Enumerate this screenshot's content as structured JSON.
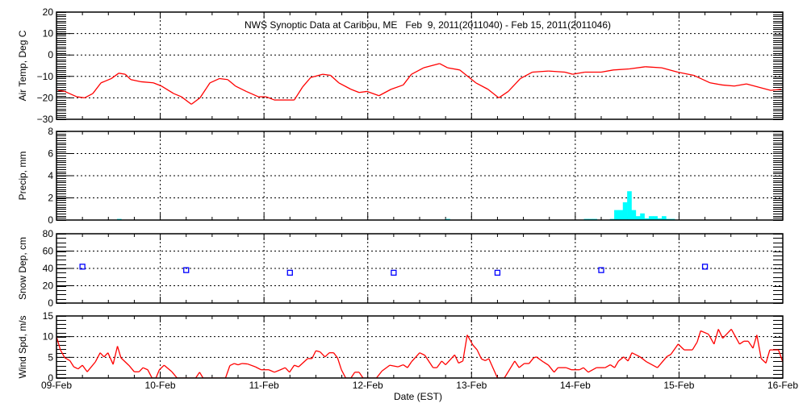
{
  "chart_data": [
    {
      "type": "line",
      "title": "NWS Synoptic Data at Caribou, ME   Feb  9, 2011(2011040) - Feb 15, 2011(2011046)",
      "ylabel": "Air Temp, Deg C",
      "ylim": [
        -30,
        20
      ],
      "yticks": [
        "20",
        "10",
        "0",
        "−10",
        "−20",
        "−30"
      ],
      "ytick_values": [
        20,
        10,
        0,
        -10,
        -20,
        -30
      ],
      "color": "#ff0000",
      "x_hours": [
        0.4,
        1.9,
        4.7,
        6.5,
        8.4,
        10.3,
        12.7,
        14.4,
        15.9,
        17.2,
        19.6,
        22.4,
        24.3,
        27.1,
        28.9,
        31.2,
        33.2,
        35.5,
        37.7,
        39.6,
        41.4,
        43.9,
        46.7,
        48.5,
        50.4,
        53.2,
        55.0,
        56.9,
        58.8,
        61.6,
        63.4,
        65.3,
        68.1,
        70.0,
        71.8,
        74.6,
        77.4,
        80.2,
        82.1,
        84.9,
        88.6,
        90.5,
        93.3,
        97.0,
        99.8,
        102.3,
        104.5,
        107.3,
        110.1,
        113.8,
        117.6,
        119.4,
        122.2,
        126.0,
        128.8,
        132.5,
        136.2,
        140.0,
        143.7,
        147.4,
        151.2,
        154.0,
        156.8,
        159.6,
        162.4,
        165.2,
        167.6
      ],
      "values": [
        -16.5,
        -17,
        -19.5,
        -20,
        -18,
        -13,
        -11,
        -8.5,
        -9,
        -11.5,
        -12.5,
        -13,
        -14.5,
        -18,
        -19.5,
        -23,
        -20,
        -13,
        -11,
        -11.5,
        -14.5,
        -17,
        -19.5,
        -19.5,
        -21,
        -21,
        -21,
        -15,
        -10.5,
        -9,
        -9.5,
        -13,
        -16,
        -17.5,
        -17,
        -19,
        -16,
        -14,
        -9,
        -6,
        -4,
        -6,
        -7,
        -13,
        -16,
        -20,
        -17,
        -11,
        -8,
        -7.5,
        -8,
        -9,
        -8,
        -8,
        -7,
        -6.5,
        -5.5,
        -6,
        -8,
        -9.5,
        -13,
        -14,
        -14.5,
        -13.5,
        -15,
        -16.5,
        -16
      ]
    },
    {
      "type": "bar",
      "ylabel": "Precip, mm",
      "ylim": [
        0,
        8
      ],
      "yticks": [
        "8",
        "6",
        "4",
        "2",
        "0"
      ],
      "ytick_values": [
        8,
        6,
        4,
        2,
        0
      ],
      "color": "#00ffff",
      "x_hours": [
        14,
        90,
        122,
        123,
        124,
        128,
        129,
        130,
        131,
        132,
        133,
        134,
        135,
        136,
        137,
        138,
        139,
        140,
        141,
        142
      ],
      "values": [
        0.1,
        0.1,
        0.1,
        0.1,
        0.1,
        0.1,
        0.9,
        0.9,
        1.6,
        2.6,
        0.9,
        0.35,
        0.6,
        0.15,
        0.35,
        0.35,
        0.15,
        0.35,
        0.1,
        0.1
      ]
    },
    {
      "type": "scatter",
      "ylabel": "Snow Dep, cm",
      "ylim": [
        0,
        80
      ],
      "yticks": [
        "80",
        "60",
        "40",
        "20",
        "0"
      ],
      "ytick_values": [
        80,
        60,
        40,
        20,
        0
      ],
      "color": "#0000ff",
      "x_hours": [
        6,
        30,
        54,
        78,
        102,
        126,
        150
      ],
      "values": [
        42,
        38,
        35,
        35,
        35,
        38,
        42
      ]
    },
    {
      "type": "line",
      "ylabel": "Wind Spd, m/s",
      "xlabel": "Date (EST)",
      "ylim": [
        0,
        15
      ],
      "yticks": [
        "15",
        "10",
        "5",
        "0"
      ],
      "ytick_values": [
        15,
        10,
        5,
        0
      ],
      "color": "#ff0000",
      "xticks": [
        "09-Feb",
        "10-Feb",
        "11-Feb",
        "12-Feb",
        "13-Feb",
        "14-Feb",
        "15-Feb",
        "16-Feb"
      ],
      "xlim_hours": [
        0,
        168
      ],
      "x_hours": [
        0,
        0.9,
        1.9,
        3.1,
        4.0,
        5.0,
        6.0,
        7.1,
        9.0,
        10.1,
        11.0,
        11.9,
        13.1,
        14.1,
        14.9,
        16.8,
        18.0,
        19.1,
        20.0,
        21.1,
        22.1,
        23.0,
        23.8,
        24.9,
        26.7,
        27.9,
        32.2,
        33.1,
        33.9,
        39.1,
        40.1,
        41.1,
        42.0,
        42.9,
        44.2,
        46.0,
        47.3,
        49.1,
        50.4,
        51.6,
        52.9,
        53.9,
        55.0,
        56.0,
        58.1,
        59.1,
        60.0,
        61.0,
        62.1,
        63.1,
        64.1,
        65.0,
        65.9,
        66.9,
        68.1,
        69.0,
        70.0,
        70.9,
        74.0,
        75.3,
        77.1,
        79.0,
        80.2,
        81.2,
        82.1,
        84.0,
        85.2,
        87.1,
        88.0,
        89.1,
        90.0,
        92.1,
        93.0,
        94.0,
        95.0,
        96.3,
        97.3,
        98.3,
        99.2,
        100.0,
        102.0,
        103.6,
        106.0,
        107.0,
        108.2,
        109.3,
        110.4,
        111.0,
        112.6,
        113.8,
        115.1,
        116.0,
        117.9,
        119.1,
        121.0,
        121.9,
        123.0,
        124.9,
        126.9,
        128.1,
        129.1,
        130.0,
        131.2,
        132.2,
        133.1,
        135.0,
        136.5,
        139.0,
        141.2,
        142.1,
        143.8,
        145.2,
        147.1,
        148.2,
        149.0,
        150.8,
        152.1,
        153.1,
        154.1,
        156.1,
        158.0,
        159.0,
        160.0,
        161.1,
        162.0,
        163.0,
        164.1,
        165.0,
        167.0,
        168.0
      ],
      "values": [
        10,
        6.8,
        4.9,
        4.2,
        2.7,
        2.2,
        3.1,
        1.5,
        3.9,
        6.1,
        5.1,
        6.1,
        3.3,
        7.7,
        4.9,
        3,
        1.5,
        1.5,
        2.5,
        2,
        0,
        0,
        2,
        3.1,
        1.5,
        0,
        0,
        1.4,
        0,
        0,
        3,
        3.5,
        3.2,
        3.5,
        3.4,
        2.7,
        2,
        2,
        1.4,
        1.9,
        2.5,
        1.4,
        3.1,
        2.7,
        4.7,
        4.7,
        6.6,
        6.3,
        5.1,
        6.1,
        6.1,
        4.9,
        2,
        0,
        0,
        1.4,
        1.4,
        0,
        0,
        1.7,
        3.1,
        2.7,
        3.2,
        2.5,
        3.9,
        6.1,
        5.5,
        2.5,
        2.5,
        4.1,
        3.2,
        5.6,
        3.6,
        4.1,
        10.4,
        8.0,
        6.8,
        4.6,
        4.2,
        4.7,
        0,
        0,
        4.1,
        2.5,
        3.5,
        3.5,
        4.9,
        5.1,
        3.9,
        3.1,
        1.4,
        2.5,
        2.5,
        2,
        2,
        2.5,
        1.4,
        2.5,
        2.5,
        3.2,
        2.5,
        4.1,
        5.1,
        4.1,
        6.1,
        5.1,
        3.9,
        2.5,
        5.2,
        5.7,
        8.2,
        6.8,
        6.8,
        8.7,
        11.4,
        10.6,
        8.2,
        11.8,
        9.6,
        11.8,
        8.2,
        8.9,
        8.9,
        7.2,
        10.4,
        4.7,
        3.6,
        6.8,
        6.8,
        3.9
      ]
    }
  ]
}
